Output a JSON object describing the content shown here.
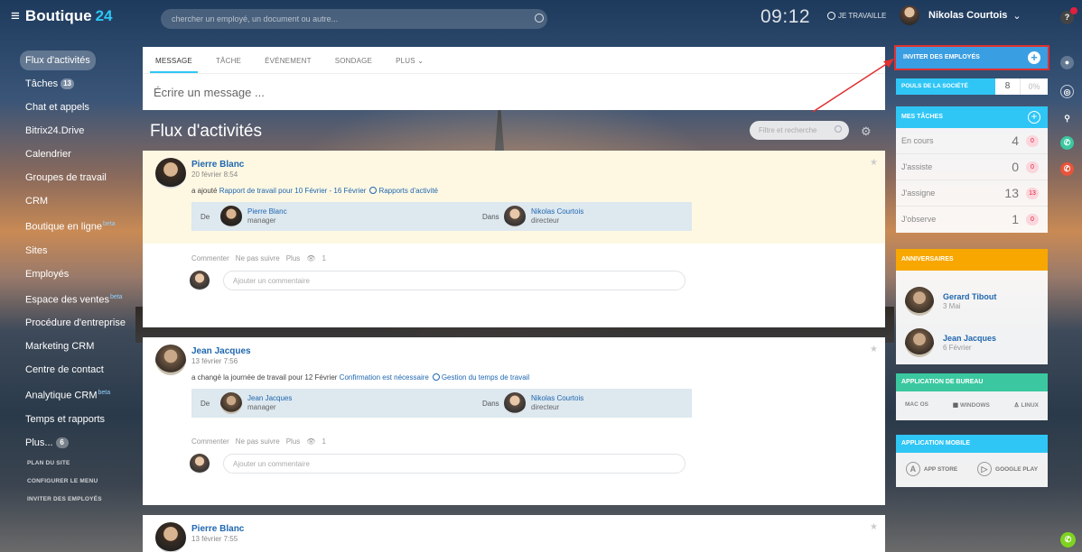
{
  "header": {
    "logo_name": "Boutique",
    "logo_num": "24",
    "search_placeholder": "chercher un employé, un document ou autre...",
    "clock": "09:12",
    "work_status": "JE TRAVAILLE",
    "user_name": "Nikolas Courtois"
  },
  "sidebar": {
    "items": [
      {
        "label": "Flux d'activités"
      },
      {
        "label": "Tâches",
        "count": "13"
      },
      {
        "label": "Chat et appels"
      },
      {
        "label": "Bitrix24.Drive"
      },
      {
        "label": "Calendrier"
      },
      {
        "label": "Groupes de travail"
      },
      {
        "label": "CRM"
      },
      {
        "label": "Boutique en ligne",
        "sup": "beta"
      },
      {
        "label": "Sites"
      },
      {
        "label": "Employés"
      },
      {
        "label": "Espace des ventes",
        "sup": "beta"
      },
      {
        "label": "Procédure d'entreprise"
      },
      {
        "label": "Marketing CRM"
      },
      {
        "label": "Centre de contact"
      },
      {
        "label": "Analytique CRM",
        "sup": "beta"
      },
      {
        "label": "Temps et rapports"
      },
      {
        "label": "Plus...",
        "count": "6"
      }
    ],
    "small_links": [
      "PLAN DU SITE",
      "CONFIGURER LE MENU",
      "INVITER DES EMPLOYÉS"
    ]
  },
  "composer": {
    "tabs": [
      "MESSAGE",
      "TÂCHE",
      "ÉVÉNEMENT",
      "SONDAGE",
      "PLUS"
    ],
    "placeholder": "Écrire un message ..."
  },
  "feed": {
    "title": "Flux d'activités",
    "filter_placeholder": "Filtre et recherche"
  },
  "posts": [
    {
      "author": "Pierre Blanc",
      "date": "20 février 8:54",
      "action_prefix": "a ajouté",
      "action_link": "Rapport de travail pour 10 Février - 16 Février",
      "action_tag": "Rapports d'activité",
      "from_label": "De",
      "from_name": "Pierre Blanc",
      "from_role": "manager",
      "in_label": "Dans",
      "in_name": "Nikolas Courtois",
      "in_role": "directeur",
      "comment": "Commenter",
      "unfollow": "Ne pas suivre",
      "more": "Plus",
      "views": "1",
      "comment_placeholder": "Ajouter un commentaire"
    },
    {
      "author": "Jean Jacques",
      "date": "13 février 7:56",
      "action_prefix": "a changé la journée de travail pour 12 Février",
      "action_link": "Confirmation est nécessaire",
      "action_tag": "Gestion du temps de travail",
      "from_label": "De",
      "from_name": "Jean Jacques",
      "from_role": "manager",
      "in_label": "Dans",
      "in_name": "Nikolas Courtois",
      "in_role": "directeur",
      "comment": "Commenter",
      "unfollow": "Ne pas suivre",
      "more": "Plus",
      "views": "1",
      "comment_placeholder": "Ajouter un commentaire"
    },
    {
      "author": "Pierre Blanc",
      "date": "13 février 7:55"
    }
  ],
  "right": {
    "invite_label": "INVITER DES EMPLOYÉS",
    "pulse_label": "POULS DE LA SOCIÉTÉ",
    "pulse_value": "8",
    "pulse_percent": "0%",
    "tasks_title": "MES TÂCHES",
    "tasks": [
      {
        "label": "En cours",
        "value": "4",
        "badge": "0"
      },
      {
        "label": "J'assiste",
        "value": "0",
        "badge": "0"
      },
      {
        "label": "J'assigne",
        "value": "13",
        "badge": "13"
      },
      {
        "label": "J'observe",
        "value": "1",
        "badge": "0"
      }
    ],
    "birthdays_title": "ANNIVERSAIRES",
    "birthdays": [
      {
        "name": "Gerard Tibout",
        "date": "3 Mai"
      },
      {
        "name": "Jean Jacques",
        "date": "6 Février"
      }
    ],
    "desktop_title": "APPLICATION DE BUREAU",
    "desktop": [
      "MAC OS",
      "WINDOWS",
      "LINUX"
    ],
    "mobile_title": "APPLICATION MOBILE",
    "mobile": [
      "APP STORE",
      "GOOGLE PLAY"
    ]
  },
  "colors": {
    "accent": "#2fc6f6",
    "invite": "#3a9ee2",
    "birthday": "#f7a700",
    "desktop": "#3bc8a0",
    "highlight": "#e03030"
  }
}
